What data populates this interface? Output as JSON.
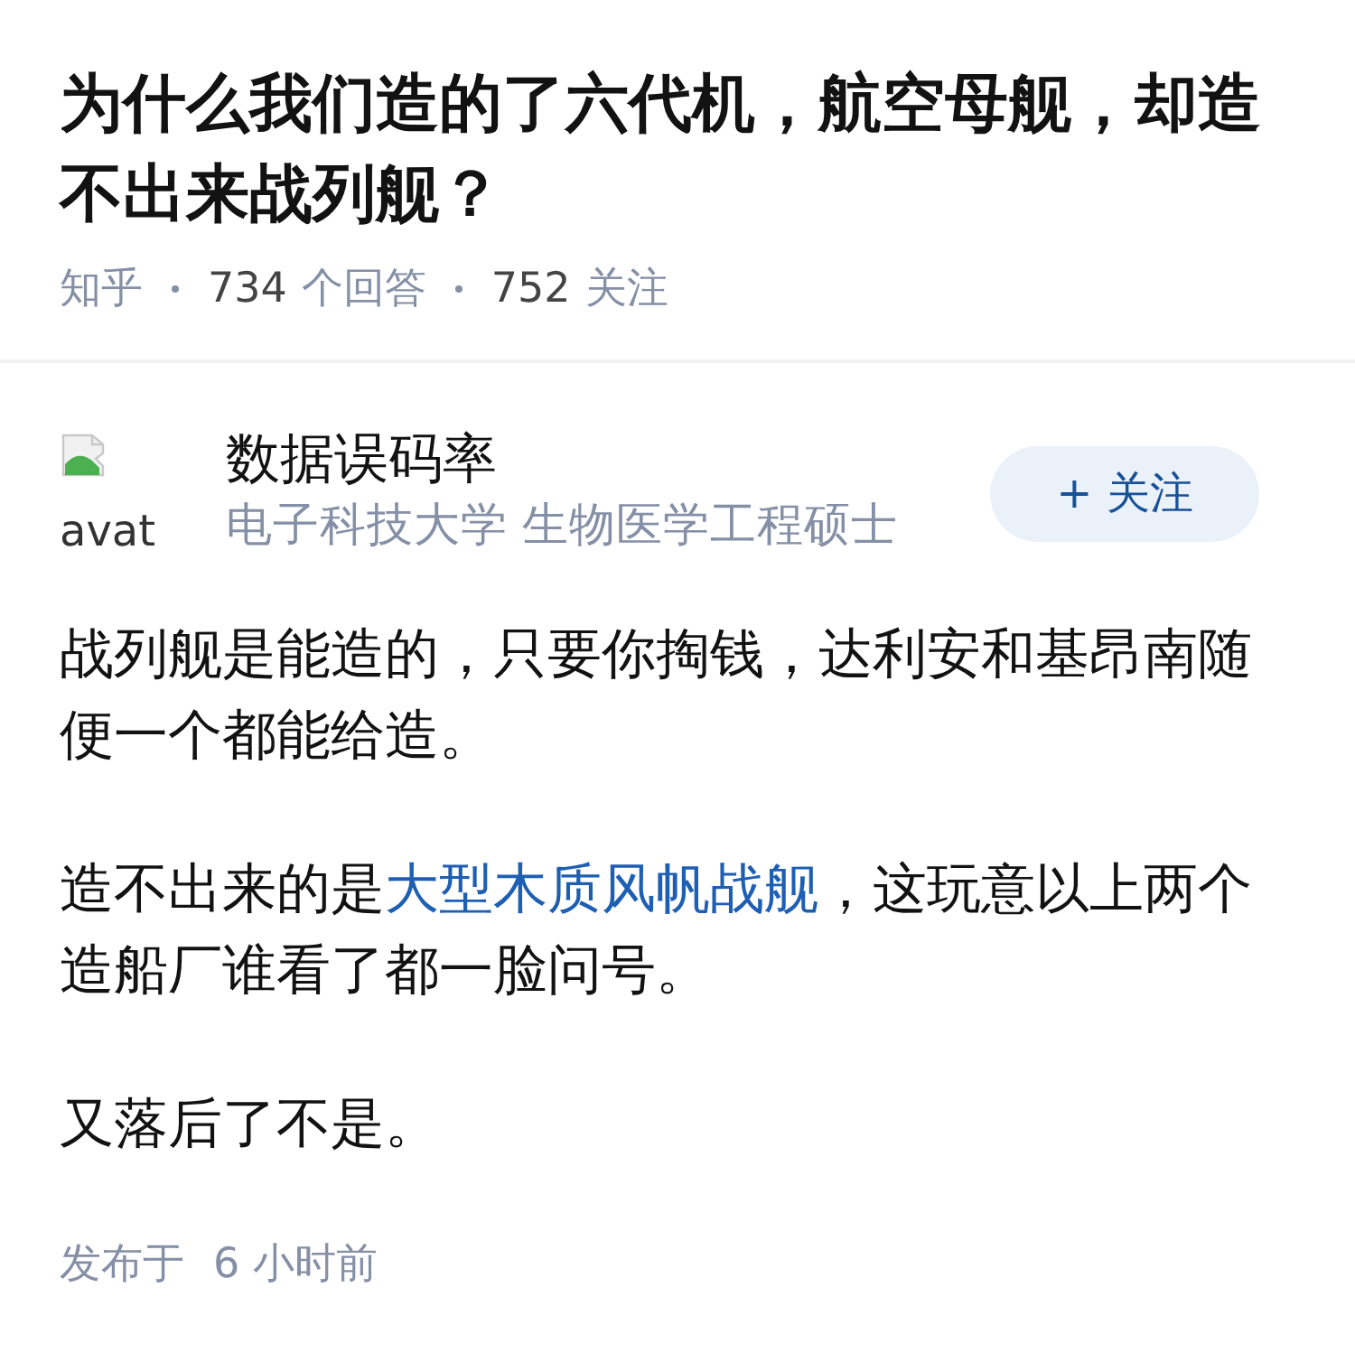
{
  "question": {
    "title": "为什么我们造的了六代机，航空母舰，却造不出来战列舰？",
    "source": "知乎",
    "answer_count": "734",
    "answer_label": "个回答",
    "follower_count": "752",
    "follower_label": "关注"
  },
  "answer": {
    "author": {
      "avatar_alt": "avat",
      "name": "数据误码率",
      "headline": "电子科技大学 生物医学工程硕士",
      "follow_button": "+ 关注"
    },
    "paragraphs": [
      {
        "parts": [
          {
            "kind": "text",
            "text": "战列舰是能造的，只要你掏钱，达利安和基昂南随便一个都能给造。"
          }
        ]
      },
      {
        "parts": [
          {
            "kind": "text",
            "text": "造不出来的是"
          },
          {
            "kind": "link",
            "text": "大型木质风帆战舰"
          },
          {
            "kind": "text",
            "text": "，这玩意以上两个造船厂谁看了都一脸问号。"
          }
        ]
      },
      {
        "parts": [
          {
            "kind": "text",
            "text": "又落后了不是。"
          }
        ]
      }
    ],
    "published": {
      "label": "发布于",
      "time": "6 小时前"
    }
  }
}
